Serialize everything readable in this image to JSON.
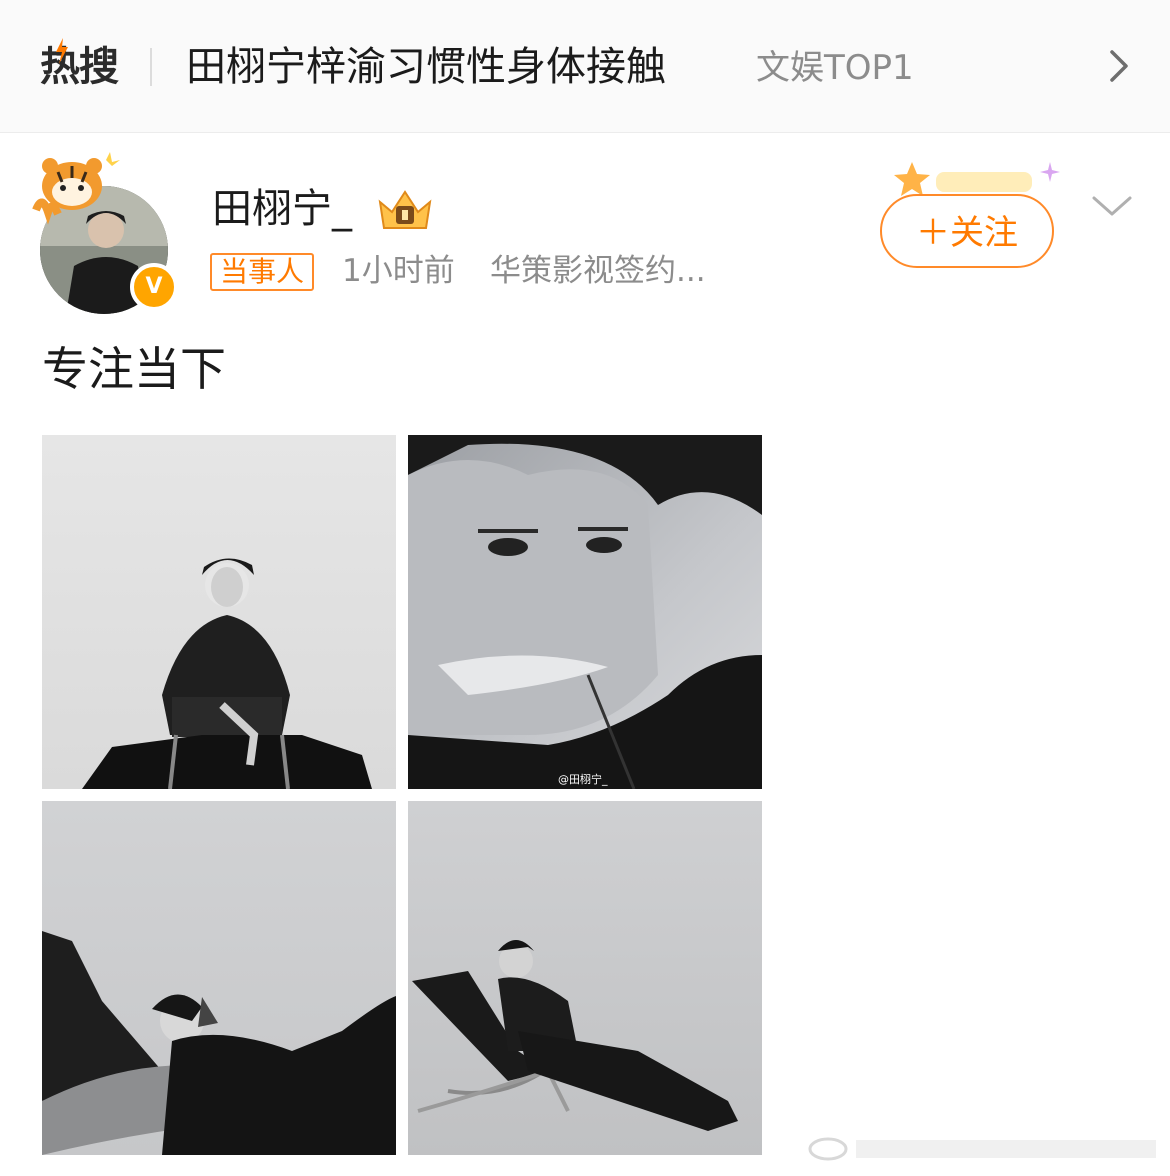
{
  "hot_search": {
    "logo_text": "热搜",
    "topic": "田栩宁梓渝习惯性身体接触",
    "tag": "文娱TOP1",
    "arrow_icon": "chevron-right-icon"
  },
  "post": {
    "username": "田栩宁_",
    "role_badge": "当事人",
    "time": "1小时前",
    "source": "华策影视签约...",
    "follow_label": "＋关注",
    "text": "专注当下",
    "verified_badge": "V",
    "photo_watermark": "@田栩宁_"
  },
  "photos": [
    {
      "alt": "photo-1"
    },
    {
      "alt": "photo-2"
    },
    {
      "alt": "photo-3"
    },
    {
      "alt": "photo-4"
    }
  ],
  "colors": {
    "accent": "#ff7a00",
    "muted": "#8c8c8c",
    "text": "#1b1b1b"
  }
}
